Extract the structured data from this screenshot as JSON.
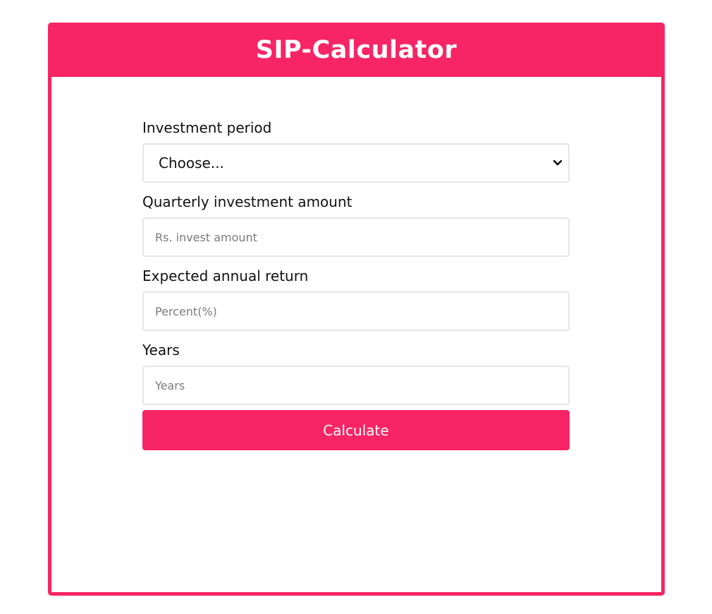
{
  "header": {
    "title": "SIP-Calculator"
  },
  "form": {
    "investment_period": {
      "label": "Investment period",
      "selected": "Choose..."
    },
    "investment_amount": {
      "label": "Quarterly investment amount",
      "placeholder": "Rs. invest amount",
      "value": ""
    },
    "annual_return": {
      "label": "Expected annual return",
      "placeholder": "Percent(%)",
      "value": ""
    },
    "years": {
      "label": "Years",
      "placeholder": "Years",
      "value": ""
    },
    "submit_label": "Calculate"
  },
  "colors": {
    "accent": "#f72565",
    "border": "#e6e6e6",
    "text": "#111111",
    "placeholder": "#7a7a7a"
  },
  "icons": {
    "select_arrow": "chevron-down-icon"
  }
}
